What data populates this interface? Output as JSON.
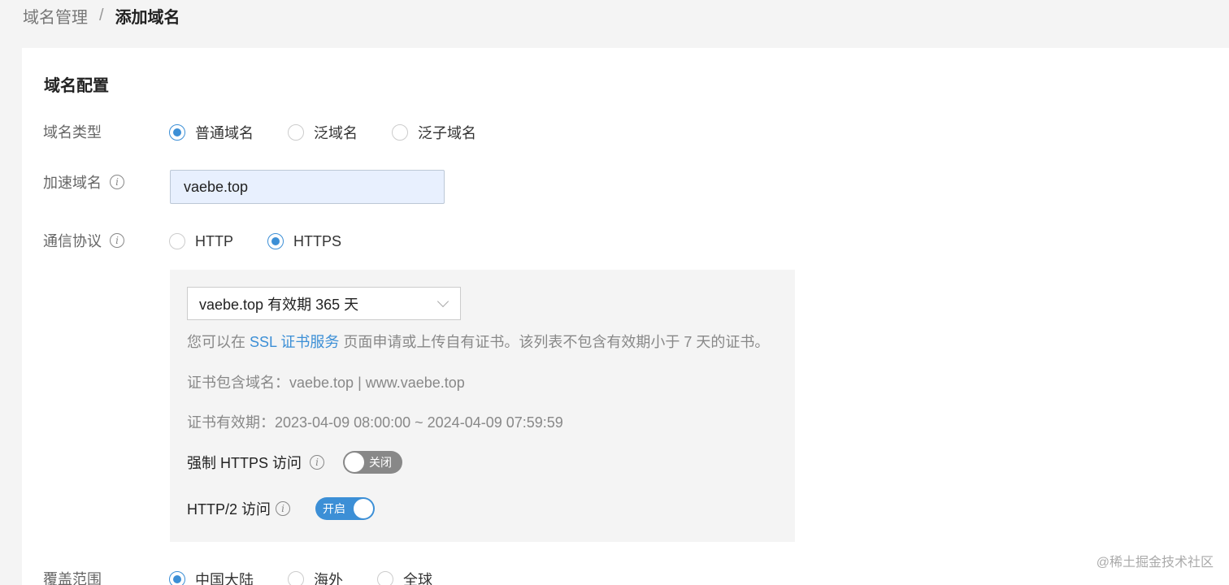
{
  "breadcrumb": {
    "parent": "域名管理",
    "separator": "/",
    "current": "添加域名"
  },
  "section_title": "域名配置",
  "domain_type": {
    "label": "域名类型",
    "options": [
      "普通域名",
      "泛域名",
      "泛子域名"
    ],
    "selected": "普通域名"
  },
  "accelerated_domain": {
    "label": "加速域名",
    "value": "vaebe.top"
  },
  "protocol": {
    "label": "通信协议",
    "options": [
      "HTTP",
      "HTTPS"
    ],
    "selected": "HTTPS"
  },
  "https_config": {
    "certificate_select": "vaebe.top 有效期 365 天",
    "hint_prefix": "您可以在",
    "hint_link": "SSL 证书服务",
    "hint_suffix": "页面申请或上传自有证书。该列表不包含有效期小于 7 天的证书。",
    "cert_domains": "证书包含域名：vaebe.top | www.vaebe.top",
    "cert_validity": "证书有效期：2023-04-09 08:00:00 ~ 2024-04-09 07:59:59",
    "force_https": {
      "label": "强制 HTTPS 访问",
      "state": "关闭"
    },
    "http2": {
      "label": "HTTP/2 访问",
      "state": "开启"
    }
  },
  "coverage": {
    "label": "覆盖范围",
    "options": [
      "中国大陆",
      "海外",
      "全球"
    ],
    "selected": "中国大陆"
  },
  "info_icon": "info-icon",
  "accent_color": "#3c8fd6",
  "watermark": "@稀土掘金技术社区"
}
